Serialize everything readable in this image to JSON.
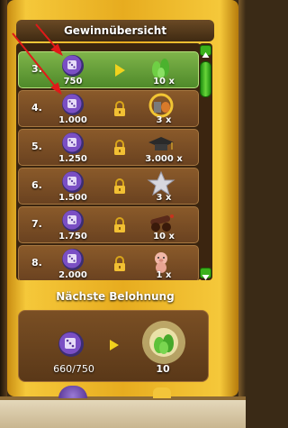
{
  "panel": {
    "title": "Gewinnübersicht",
    "next_title": "Nächste Belohnung"
  },
  "rewards": [
    {
      "rank": "3.",
      "price": "750",
      "count": "10 x",
      "icon": "green-gem-cluster-icon",
      "status": "arrow-icon",
      "active": true
    },
    {
      "rank": "4.",
      "price": "1.000",
      "count": "3 x",
      "icon": "golden-wreath-items-icon",
      "status": "padlock-icon",
      "active": false
    },
    {
      "rank": "5.",
      "price": "1.250",
      "count": "3.000 x",
      "icon": "graduation-cap-icon",
      "status": "padlock-icon",
      "active": false
    },
    {
      "rank": "6.",
      "price": "1.500",
      "count": "3 x",
      "icon": "silver-star-icon",
      "status": "padlock-icon",
      "active": false
    },
    {
      "rank": "7.",
      "price": "1.750",
      "count": "10 x",
      "icon": "cannon-icon",
      "status": "padlock-icon",
      "active": false
    },
    {
      "rank": "8.",
      "price": "2.000",
      "count": "1 x",
      "icon": "pig-figure-icon",
      "status": "padlock-icon",
      "active": false
    }
  ],
  "next_reward": {
    "progress": "660/750",
    "count": "10",
    "icon": "glowing-green-gem-icon"
  },
  "colors": {
    "frame_gold": "#e7ac1f",
    "row_brown": "#7a4e24",
    "row_active_green": "#6aa23c",
    "token_purple": "#7a4fc4",
    "scroll_green": "#3bb11b",
    "annotation_red": "#e01919"
  }
}
